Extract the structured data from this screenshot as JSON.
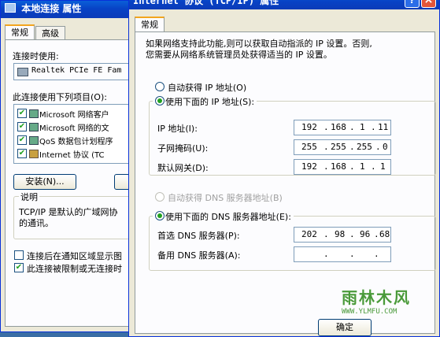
{
  "left_window": {
    "title": "本地连接 属性",
    "tabs": [
      {
        "label": "常规"
      },
      {
        "label": "高级"
      }
    ],
    "connect_using_label": "连接时使用:",
    "adapter_name": "Realtek PCIe FE Fam",
    "items_label": "此连接使用下列项目(O):",
    "items": [
      {
        "label": "Microsoft 网络客户",
        "checked": true
      },
      {
        "label": "Microsoft 网络的文",
        "checked": true
      },
      {
        "label": "QoS 数据包计划程序",
        "checked": true
      },
      {
        "label": "Internet 协议 (TC",
        "checked": true
      }
    ],
    "install_button": "安装(N)...",
    "uninstall_button": "卸",
    "description_title": "说明",
    "description_line1": "TCP/IP 是默认的广域网协",
    "description_line2": "的通讯。",
    "show_icon_label": "连接后在通知区域显示图",
    "show_icon_checked": false,
    "notify_label": "此连接被限制或无连接时",
    "notify_checked": true
  },
  "right_window": {
    "title": "Internet 协议 (TCP/IP) 属性",
    "help_button": "?",
    "close_button": "×",
    "tab": "常规",
    "intro_line1": "如果网络支持此功能,则可以获取自动指派的 IP 设置。否则,",
    "intro_line2": "您需要从网络系统管理员处获得适当的 IP 设置。",
    "auto_ip_label": "自动获得 IP 地址(O)",
    "auto_ip_selected": false,
    "manual_ip_label": "使用下面的 IP 地址(S):",
    "manual_ip_selected": true,
    "ip_label": "IP 地址(I):",
    "ip_value": [
      "192",
      "168",
      "1",
      "11"
    ],
    "mask_label": "子网掩码(U):",
    "mask_value": [
      "255",
      "255",
      "255",
      "0"
    ],
    "gateway_label": "默认网关(D):",
    "gateway_value": [
      "192",
      "168",
      "1",
      "1"
    ],
    "auto_dns_label": "自动获得 DNS 服务器地址(B)",
    "auto_dns_selected": false,
    "manual_dns_label": "使用下面的 DNS 服务器地址(E):",
    "manual_dns_selected": true,
    "preferred_dns_label": "首选 DNS 服务器(P):",
    "preferred_dns_value": [
      "202",
      "98",
      "96",
      "68"
    ],
    "alternate_dns_label": "备用 DNS 服务器(A):",
    "alternate_dns_value": [
      "",
      "",
      "",
      ""
    ],
    "ok_button": "确定"
  },
  "watermark": {
    "text": "雨林木风",
    "url": "WWW.YLMFU.COM"
  }
}
